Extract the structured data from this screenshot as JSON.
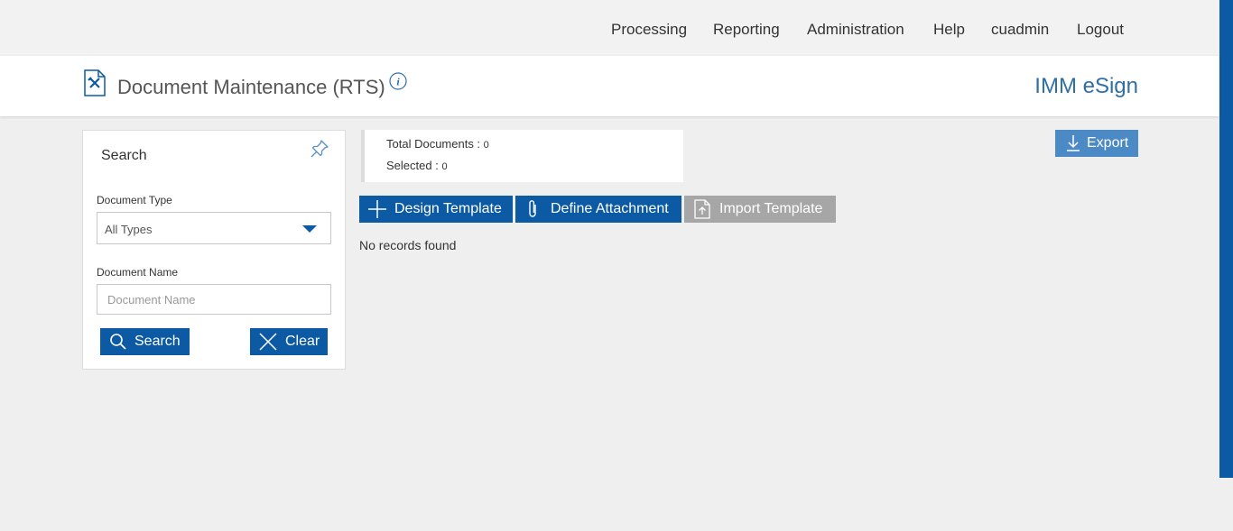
{
  "nav": {
    "items": [
      "Processing",
      "Reporting",
      "Administration",
      "Help",
      "cuadmin",
      "Logout"
    ]
  },
  "header": {
    "title": "Document Maintenance (RTS)",
    "brand": "IMM eSign",
    "icons": {
      "page": "document-tools-icon",
      "info": "info-icon"
    }
  },
  "search": {
    "title": "Search",
    "document_type_label": "Document Type",
    "document_type_value": "All Types",
    "document_name_label": "Document Name",
    "document_name_placeholder": "Document Name",
    "document_name_value": "",
    "search_button": "Search",
    "clear_button": "Clear"
  },
  "summary": {
    "total_label": "Total Documents : ",
    "total_value": "0",
    "selected_label": "Selected : ",
    "selected_value": "0"
  },
  "toolbar": {
    "design_template": "Design Template",
    "define_attachment": "Define Attachment",
    "import_template": "Import Template",
    "export": "Export"
  },
  "results": {
    "empty_message": "No records found"
  },
  "colors": {
    "accent": "#0b5aa3",
    "brand_text": "#2e6fa8",
    "disabled": "#a6a6a6",
    "export": "#4b8ac4"
  }
}
